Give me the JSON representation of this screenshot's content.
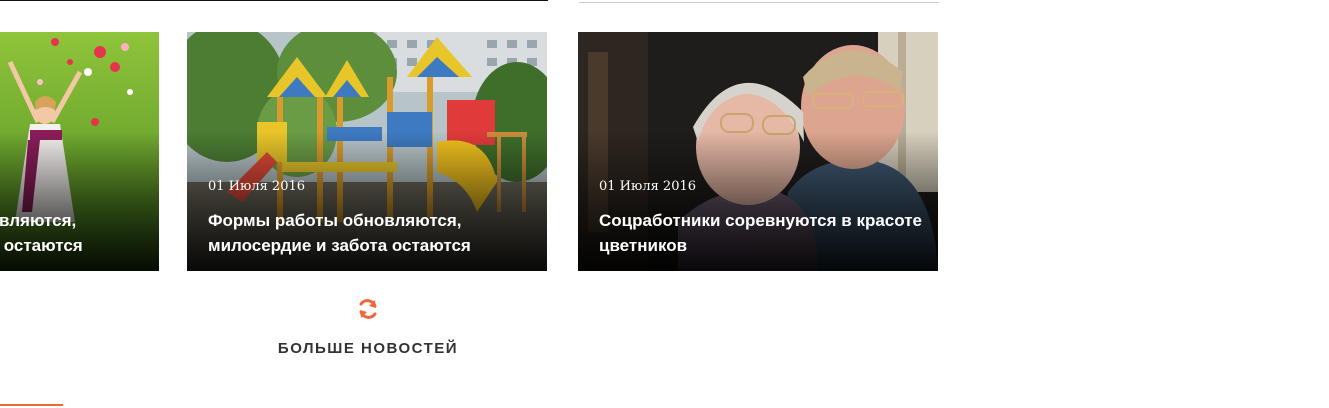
{
  "cards": [
    {
      "title": "Формы работы обновляются, милосердие и забота остаются",
      "title_partial": "вляются,\n остаются"
    },
    {
      "date": "01 Июля 2016",
      "title": "Формы работы обновляются, милосердие и забота остаются"
    },
    {
      "date": "01 Июля 2016",
      "title": "Соцработники соревнуются в красоте цветников"
    }
  ],
  "more": {
    "label": "БОЛЬШЕ НОВОСТЕЙ",
    "icon": "refresh-icon"
  },
  "colors": {
    "accent": "#f0673a",
    "text_dark": "#333333",
    "overlay_text": "#ffffff"
  }
}
